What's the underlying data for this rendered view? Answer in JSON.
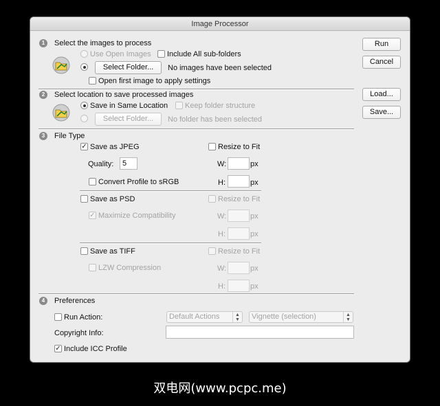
{
  "window": {
    "title": "Image Processor"
  },
  "section1": {
    "number": "1",
    "heading": "Select the images to process",
    "use_open_images": "Use Open Images",
    "include_subfolders": "Include All sub-folders",
    "select_folder": "Select Folder...",
    "status": "No images have been selected",
    "open_first": "Open first image to apply settings"
  },
  "section2": {
    "number": "2",
    "heading": "Select location to save processed images",
    "save_same": "Save in Same Location",
    "keep_structure": "Keep folder structure",
    "select_folder": "Select Folder...",
    "status": "No folder has been selected"
  },
  "section3": {
    "number": "3",
    "heading": "File Type",
    "jpeg": {
      "label": "Save as JPEG",
      "resize": "Resize to Fit",
      "quality_label": "Quality:",
      "quality_value": "5",
      "convert": "Convert Profile to sRGB",
      "w": "W:",
      "h": "H:",
      "px": "px"
    },
    "psd": {
      "label": "Save as PSD",
      "resize": "Resize to Fit",
      "maximize": "Maximize Compatibility",
      "w": "W:",
      "h": "H:",
      "px": "px"
    },
    "tiff": {
      "label": "Save as TIFF",
      "resize": "Resize to Fit",
      "lzw": "LZW Compression",
      "w": "W:",
      "h": "H:",
      "px": "px"
    }
  },
  "section4": {
    "number": "4",
    "heading": "Preferences",
    "run_action": "Run Action:",
    "action_set": "Default Actions",
    "action": "Vignette (selection)",
    "copyright": "Copyright Info:",
    "copyright_value": "",
    "icc": "Include ICC Profile"
  },
  "side_buttons": {
    "run": "Run",
    "cancel": "Cancel",
    "load": "Load...",
    "save": "Save..."
  },
  "footer": {
    "watermark": "双电网(www.pcpc.me)"
  }
}
